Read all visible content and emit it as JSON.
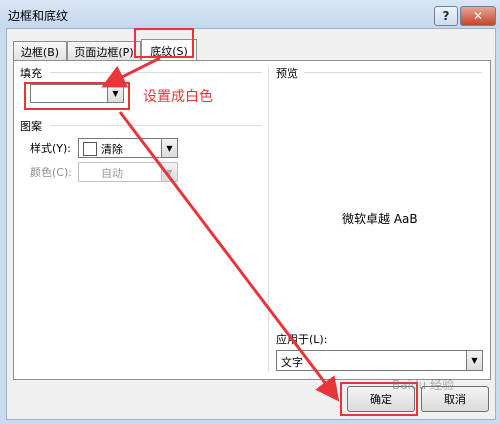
{
  "window": {
    "title": "边框和底纹",
    "help_glyph": "?",
    "close_glyph": "✕"
  },
  "tabs": [
    {
      "label": "边框(B)",
      "selected": false
    },
    {
      "label": "页面边框(P)",
      "selected": false
    },
    {
      "label": "底纹(S)",
      "selected": true
    }
  ],
  "fill": {
    "group_label": "填充",
    "value": "",
    "arrow": "▼"
  },
  "pattern": {
    "group_label": "图案",
    "style_label": "样式(Y):",
    "style_value": "清除",
    "color_label": "颜色(C):",
    "color_value": "自动",
    "arrow": "▼"
  },
  "preview": {
    "group_label": "预览",
    "sample_text": "微软卓越  AaB"
  },
  "apply_to": {
    "label": "应用于(L):",
    "value": "文字",
    "arrow": "▼"
  },
  "buttons": {
    "ok": "确定",
    "cancel": "取消"
  },
  "annotation": {
    "text": "设置成白色",
    "color": "#e8353a"
  },
  "watermark": "Baidu 经验"
}
